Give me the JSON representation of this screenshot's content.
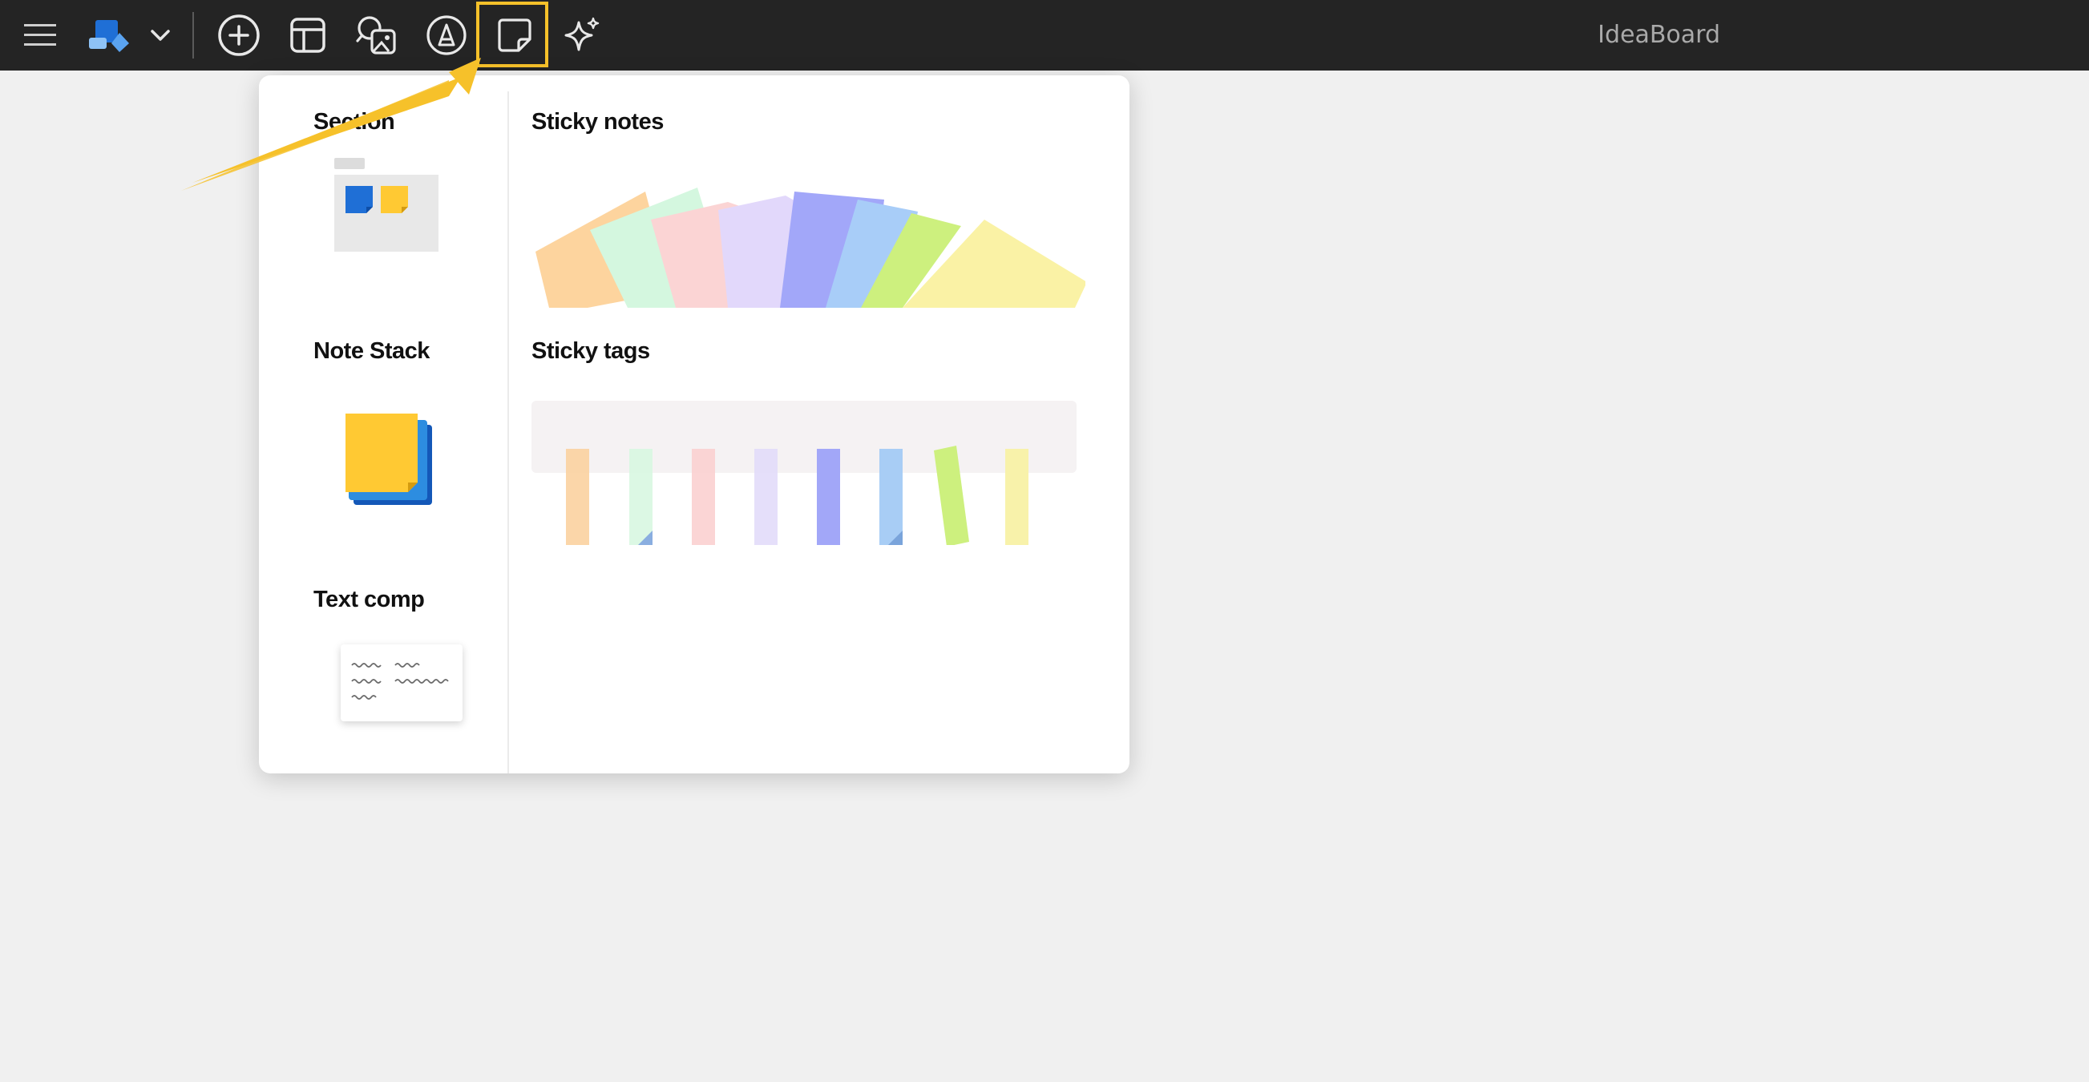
{
  "toolbar": {
    "app_title": "IdeaBoard",
    "icons": [
      "menu-icon",
      "board-logo-icon",
      "chevron-down-icon",
      "add-circle-icon",
      "template-layout-icon",
      "image-search-icon",
      "pen-circle-icon",
      "sticky-note-icon",
      "ai-sparkle-icon"
    ],
    "selected_tool": "sticky-note-icon"
  },
  "panel": {
    "section_label": "Section",
    "note_stack_label": "Note Stack",
    "text_comp_label": "Text comp",
    "sticky_notes_label": "Sticky notes",
    "sticky_tags_label": "Sticky tags"
  },
  "sticky_note_colors": [
    "#fdd49e",
    "#d4f7df",
    "#fbd4d4",
    "#e2d8fb",
    "#a2a7f9",
    "#a8cdf8",
    "#cdf07e",
    "#faf2a5"
  ],
  "sticky_tag_colors": [
    "#fbd1a0",
    "#d8f7e1",
    "#fbd0d0",
    "#e2dbfa",
    "#a2a7f8",
    "#a8cdf5",
    "#cdf07e",
    "#f8f1a5"
  ],
  "colors": {
    "toolbar_bg": "#242424",
    "canvas_bg": "#f0f0f0",
    "highlight": "#f6c12a",
    "accent_blue": "#1f6fd6",
    "accent_yellow": "#ffc933"
  }
}
